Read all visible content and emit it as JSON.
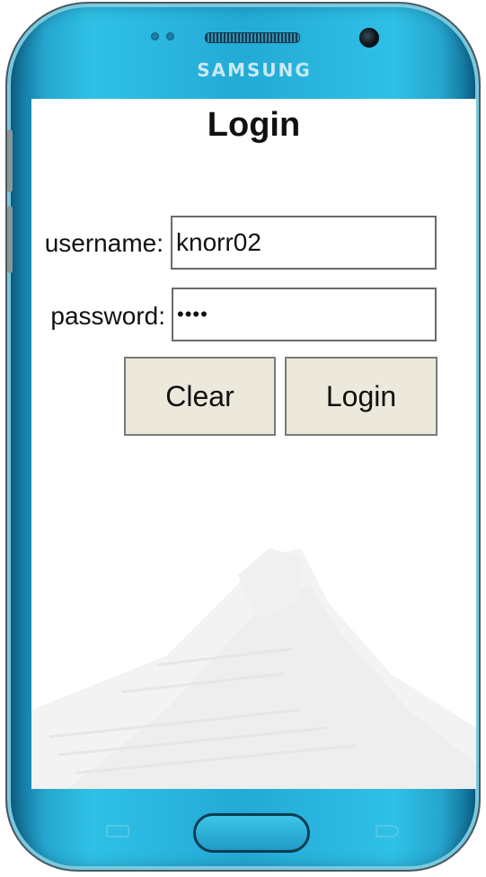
{
  "device": {
    "brand": "SAMSUNG"
  },
  "login": {
    "title": "Login",
    "username_label": "username:",
    "username_value": "knorr02",
    "password_label": "password:",
    "password_value": "••••",
    "clear_label": "Clear",
    "login_label": "Login"
  },
  "colors": {
    "phone_body": "#23aad6",
    "button_bg": "#ece8dc",
    "screen_bg": "#ffffff"
  }
}
